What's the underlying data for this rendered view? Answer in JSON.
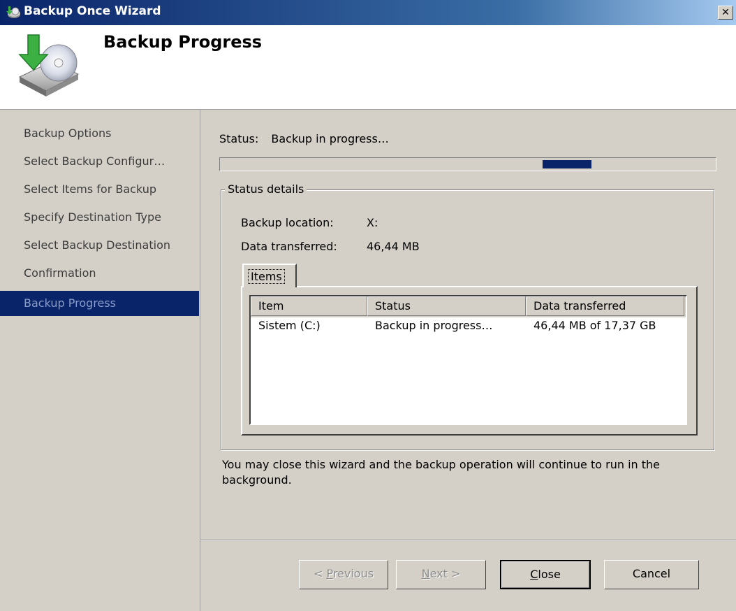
{
  "window": {
    "title": "Backup Once Wizard",
    "close_glyph": "✕",
    "icons": {
      "title": "backup-app-icon",
      "header": "backup-disk-icon",
      "close": "close-icon"
    }
  },
  "header": {
    "title": "Backup Progress"
  },
  "sidebar": {
    "items": [
      {
        "label": "Backup Options"
      },
      {
        "label": "Select Backup Configur…"
      },
      {
        "label": "Select Items for Backup"
      },
      {
        "label": "Specify Destination Type"
      },
      {
        "label": "Select Backup Destination"
      },
      {
        "label": "Confirmation"
      },
      {
        "label": "Backup Progress",
        "active": true
      }
    ]
  },
  "main": {
    "status_label": "Status:",
    "status_value": "Backup in progress…",
    "progress_indicator": "indeterminate",
    "group_title": "Status details",
    "backup_location_label": "Backup location:",
    "backup_location_value": "X:",
    "data_transferred_label": "Data transferred:",
    "data_transferred_value": "46,44 MB",
    "tab_label": "Items",
    "table": {
      "columns": [
        "Item",
        "Status",
        "Data transferred"
      ],
      "rows": [
        [
          "Sistem (C:)",
          "Backup in progress…",
          "46,44 MB of 17,37 GB"
        ]
      ]
    },
    "note": "You may close this wizard and the backup operation will continue to run in the background."
  },
  "buttons": {
    "previous": {
      "prefix": "< ",
      "mnemonic": "P",
      "rest": "revious"
    },
    "next": {
      "mnemonic": "N",
      "rest": "ext >"
    },
    "close": {
      "mnemonic": "C",
      "rest": "lose"
    },
    "cancel": "Cancel"
  },
  "colors": {
    "titlebar_start": "#0a246a",
    "titlebar_end": "#a6caf0",
    "selection": "#0a246a",
    "face": "#d4d0c8"
  }
}
